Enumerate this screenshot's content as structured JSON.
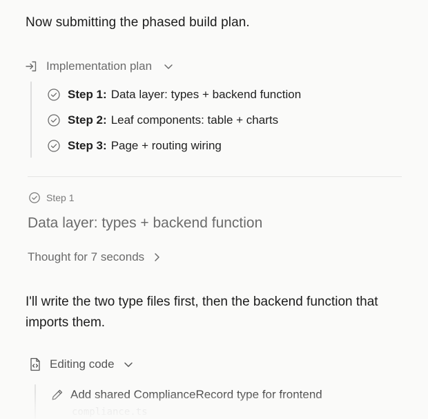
{
  "intro_text": "Now submitting the phased build plan.",
  "plan": {
    "title": "Implementation plan",
    "steps": [
      {
        "label": "Step 1:",
        "text": "Data layer: types + backend function"
      },
      {
        "label": "Step 2:",
        "text": "Leaf components: table + charts"
      },
      {
        "label": "Step 3:",
        "text": "Page + routing wiring"
      }
    ]
  },
  "current_step": {
    "tag": "Step 1",
    "title": "Data layer: types + backend function",
    "thought": "Thought for 7 seconds"
  },
  "message": "I'll write the two type files first, then the backend function that imports them.",
  "editing": {
    "title": "Editing code",
    "items": [
      {
        "text": "Add shared ComplianceRecord type for frontend",
        "file": "compliance.ts"
      }
    ]
  },
  "colors": {
    "background": "#fafaf9",
    "text": "#1c1c1c",
    "muted": "#6b6b6b",
    "rule": "#dedede"
  }
}
